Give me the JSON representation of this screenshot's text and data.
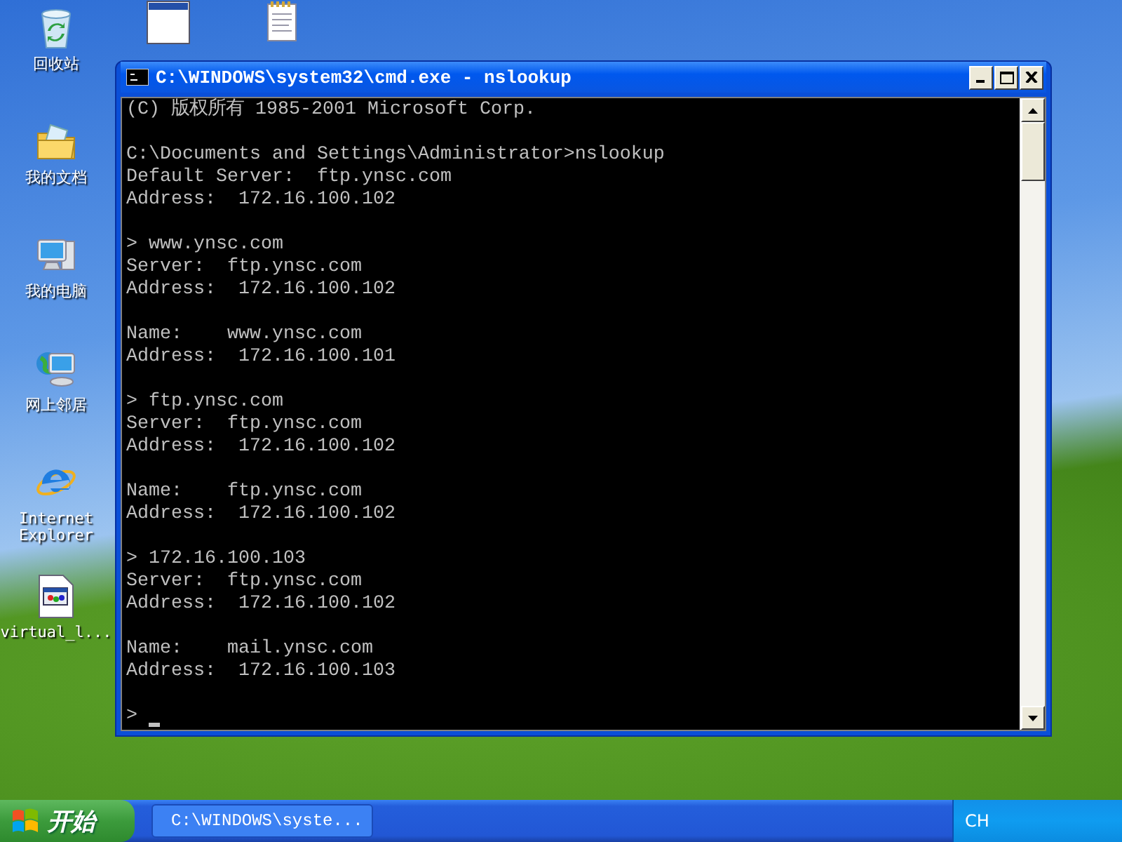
{
  "desktop_icons": [
    {
      "kind": "recycle",
      "label": "回收站"
    },
    {
      "kind": "documents",
      "label": "我的文档"
    },
    {
      "kind": "computer",
      "label": "我的电脑"
    },
    {
      "kind": "network",
      "label": "网上邻居"
    },
    {
      "kind": "browser",
      "label": "Internet Explorer"
    },
    {
      "kind": "file",
      "label": "virtual_l..."
    }
  ],
  "top_icons": [
    {
      "kind": "window"
    },
    {
      "kind": "notepad"
    }
  ],
  "window": {
    "title": "C:\\WINDOWS\\system32\\cmd.exe - nslookup"
  },
  "console": {
    "blocks": [
      [
        "(C) 版权所有 1985-2001 Microsoft Corp."
      ],
      [
        "C:\\Documents and Settings\\Administrator>nslookup",
        "Default Server:  ftp.ynsc.com",
        "Address:  172.16.100.102"
      ],
      [
        "> www.ynsc.com",
        "Server:  ftp.ynsc.com",
        "Address:  172.16.100.102"
      ],
      [
        "Name:    www.ynsc.com",
        "Address:  172.16.100.101"
      ],
      [
        "> ftp.ynsc.com",
        "Server:  ftp.ynsc.com",
        "Address:  172.16.100.102"
      ],
      [
        "Name:    ftp.ynsc.com",
        "Address:  172.16.100.102"
      ],
      [
        "> 172.16.100.103",
        "Server:  ftp.ynsc.com",
        "Address:  172.16.100.102"
      ],
      [
        "Name:    mail.ynsc.com",
        "Address:  172.16.100.103"
      ]
    ],
    "prompt": ">"
  },
  "taskbar": {
    "start_label": "开始",
    "tasks": [
      {
        "label": "C:\\WINDOWS\\syste...",
        "selected": false
      }
    ],
    "tray_text": "CH"
  }
}
